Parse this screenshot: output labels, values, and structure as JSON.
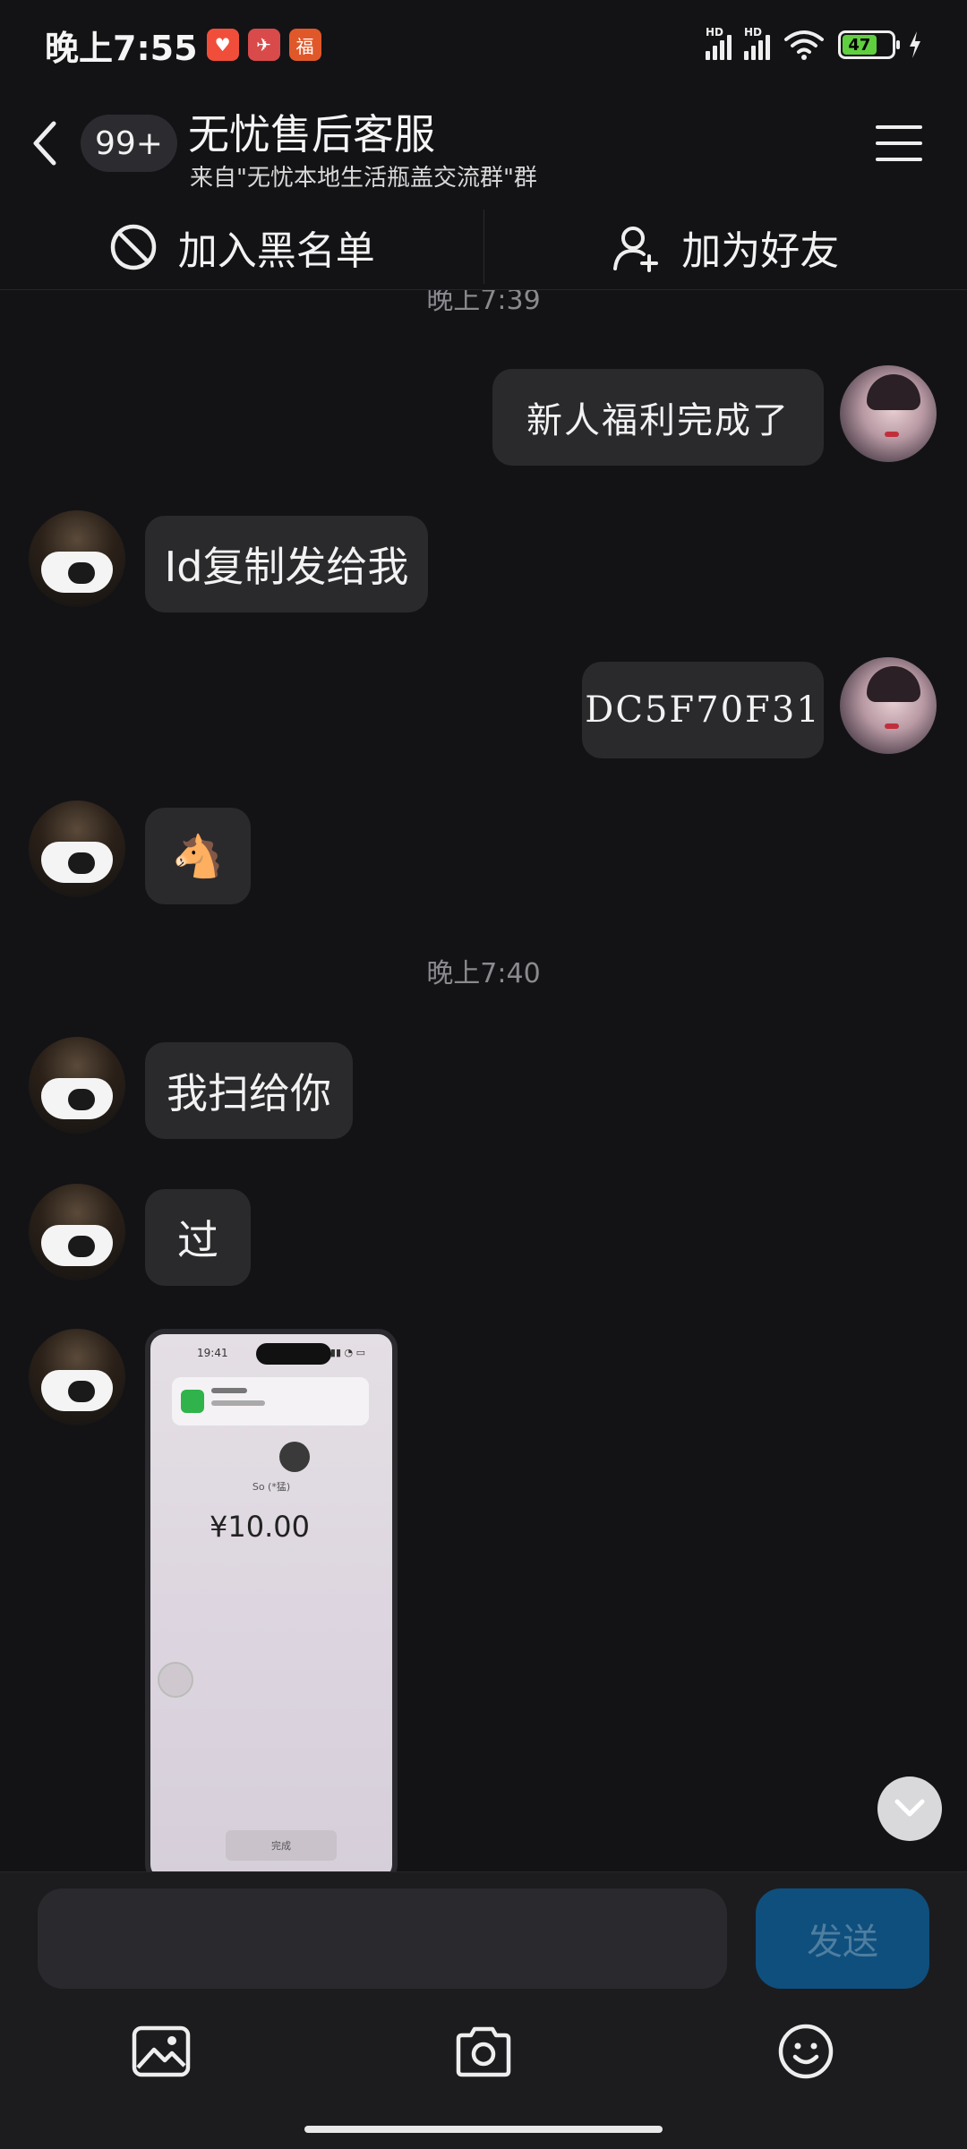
{
  "status_bar": {
    "time": "晚上7:55",
    "battery": "47",
    "network": "HD"
  },
  "header": {
    "unread_count": "99+",
    "title": "无忧售后客服",
    "subtitle": "来自\"无忧本地生活瓶盖交流群\"群"
  },
  "actions": {
    "block": "加入黑名单",
    "add_friend": "加为好友"
  },
  "messages": {
    "ts1": "晚上7:39",
    "m1": "新人福利完成了",
    "m2": "Id复制发给我",
    "m3": "DC5F70F31",
    "m4": "🐴",
    "ts2": "晚上7:40",
    "m5": "我扫给你",
    "m6": "过",
    "screenshot": {
      "phone_time": "19:41",
      "name": "So (*猛)",
      "amount": "¥10.00",
      "done": "完成"
    }
  },
  "composer": {
    "placeholder": "",
    "send": "发送"
  },
  "colors": {
    "background": "#131316",
    "bubble": "#2a2a2d",
    "send_button": "#0f4f7d",
    "timestamp": "#8a8a8e"
  },
  "icons": [
    "back-icon",
    "menu-icon",
    "block-icon",
    "add-friend-icon",
    "image-icon",
    "camera-icon",
    "emoji-icon",
    "chevron-down-icon"
  ]
}
